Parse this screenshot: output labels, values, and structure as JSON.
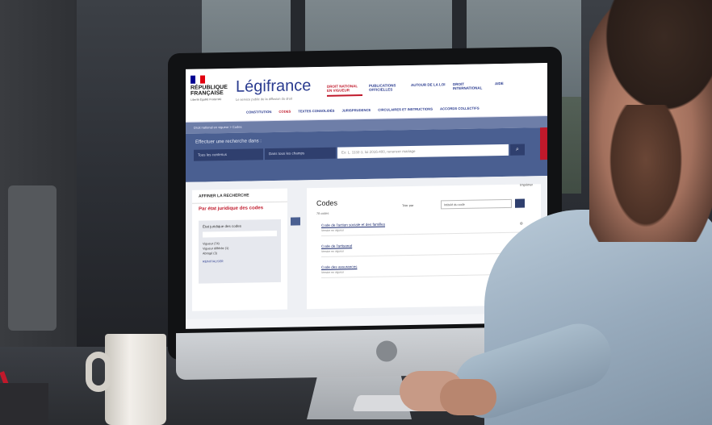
{
  "screen": {
    "logo": {
      "republic": "RÉPUBLIQUE FRANÇAISE",
      "motto": "Liberté Égalité Fraternité",
      "brand": "Légifrance",
      "tagline": "Le service public de la diffusion du droit"
    },
    "top_links": [
      "",
      "",
      ""
    ],
    "main_nav": [
      "DROIT NATIONAL EN VIGUEUR",
      "PUBLICATIONS OFFICIELLES",
      "AUTOUR DE LA LOI",
      "DROIT INTERNATIONAL",
      "AIDE"
    ],
    "sub_nav": [
      "CONSTITUTION",
      "CODES",
      "TEXTES CONSOLIDÉS",
      "JURISPRUDENCE",
      "CIRCULAIRES ET INSTRUCTIONS",
      "ACCORDS COLLECTIFS"
    ],
    "breadcrumb": "Droit national en vigueur > Codes",
    "search": {
      "label": "Effectuer une recherche dans :",
      "field1": "Tous les contenus",
      "field2": "Dans tous les champs",
      "placeholder": "Ex: L. 1132-1, loi 2016-400, renoncer mariage"
    },
    "sidebar": {
      "title": "AFFINER LA RECHERCHE",
      "subtitle": "Par état juridique des codes",
      "box_title": "État juridique des codes",
      "options": [
        "Vigueur (74)",
        "Vigueur différée (1)",
        "Abrogé (3)"
      ],
      "reset": "RÉINITIALISER"
    },
    "main": {
      "print": "Imprimer",
      "title": "Codes",
      "count": "78 codes",
      "sort_label": "Trier par",
      "sort_value": "Intitulé du code",
      "rows": [
        {
          "title": "Code de l'action sociale et des familles",
          "status": "Vigueur",
          "meta": "Version en vigueur"
        },
        {
          "title": "Code de l'artisanat",
          "status": "Vigueur",
          "meta": "Version en vigueur"
        },
        {
          "title": "Code des assurances",
          "status": "Vigueur",
          "meta": "Version en vigueur"
        }
      ]
    }
  }
}
